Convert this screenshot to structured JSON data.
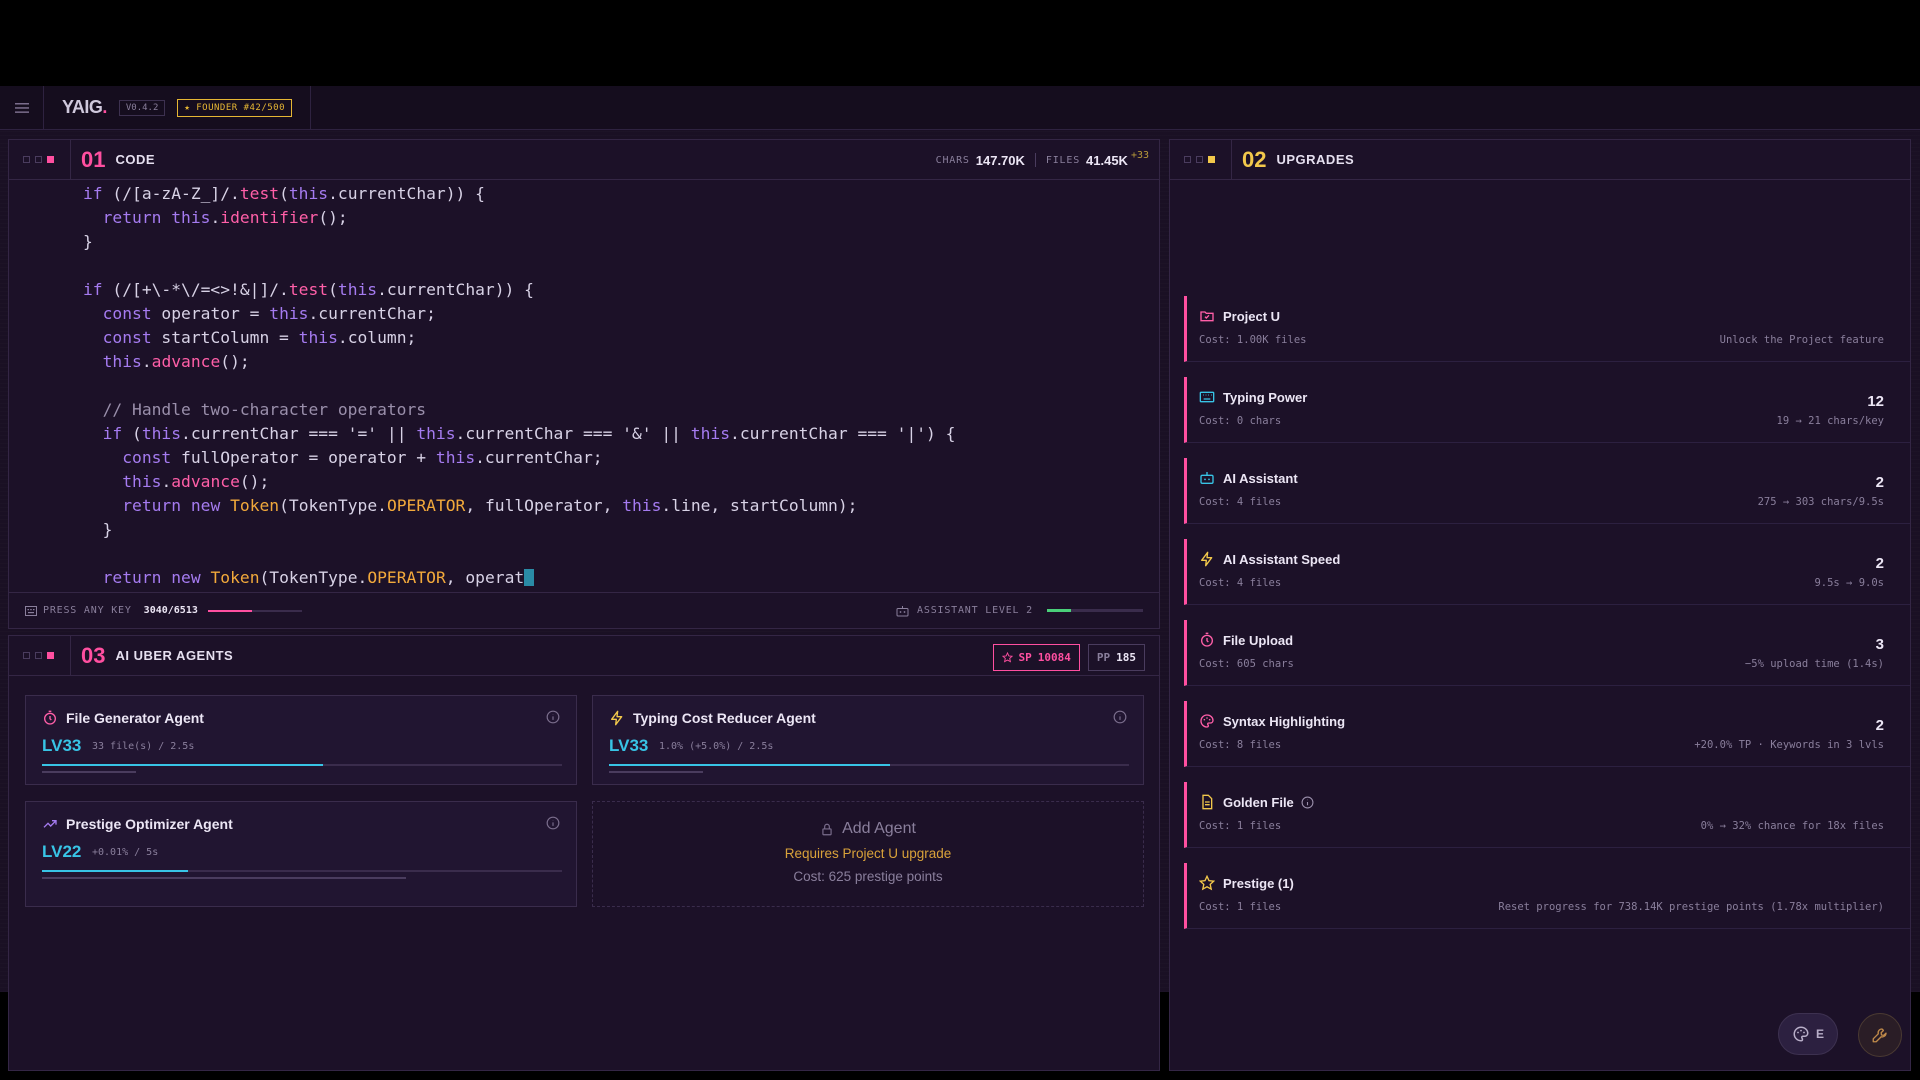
{
  "topbar": {
    "menu_icon": "hamburger-icon",
    "logo": "YAIG",
    "logo_dot": ".",
    "version": "V0.4.2",
    "founder": "★ FOUNDER #42/500"
  },
  "code_panel": {
    "number": "01",
    "title": "CODE",
    "chars_label": "CHARS",
    "chars_value": "147.70K",
    "files_label": "FILES",
    "files_value": "41.45K",
    "files_delta": "+33",
    "press_key_label": "PRESS ANY KEY",
    "progress": "3040/6513",
    "progress_fraction": 0.467,
    "assistant_label": "ASSISTANT LEVEL 2",
    "assistant_fraction": 0.25,
    "code_lines": [
      "if (/[a-zA-Z_]/.test(this.currentChar)) {",
      "  return this.identifier();",
      "}",
      "",
      "if (/[+\\-*\\/=<>!&|]/.test(this.currentChar)) {",
      "  const operator = this.currentChar;",
      "  const startColumn = this.column;",
      "  this.advance();",
      "",
      "  // Handle two-character operators",
      "  if (this.currentChar === '=' || this.currentChar === '&' || this.currentChar === '|') {",
      "    const fullOperator = operator + this.currentChar;",
      "    this.advance();",
      "    return new Token(TokenType.OPERATOR, fullOperator, this.line, startColumn);",
      "  }",
      "",
      "  return new Token(TokenType.OPERATOR, operat"
    ]
  },
  "agents_panel": {
    "number": "03",
    "title": "AI UBER AGENTS",
    "sp_label": "SP",
    "sp_value": "10084",
    "pp_label": "PP",
    "pp_value": "185",
    "agents": [
      {
        "name": "File Generator Agent",
        "icon": "timer-icon",
        "level": "LV33",
        "rate": "33 file(s) / 2.5s",
        "progress": 0.54,
        "secondary": 0.18
      },
      {
        "name": "Typing Cost Reducer Agent",
        "icon": "lightning-icon",
        "level": "LV33",
        "rate": "1.0% (+5.0%) / 2.5s",
        "progress": 0.54,
        "secondary": 0.18
      },
      {
        "name": "Prestige Optimizer Agent",
        "icon": "trending-up-icon",
        "level": "LV22",
        "rate": "+0.01% / 5s",
        "progress": 0.28,
        "secondary": 0.7
      }
    ],
    "add_agent": {
      "label": "Add Agent",
      "requires": "Requires Project U upgrade",
      "cost": "Cost: 625 prestige points"
    }
  },
  "upgrades_panel": {
    "number": "02",
    "title": "UPGRADES",
    "items": [
      {
        "name": "Project U",
        "icon": "project-icon",
        "cost": "Cost: 1.00K files",
        "level": "",
        "desc": "Unlock the Project feature"
      },
      {
        "name": "Typing Power",
        "icon": "keyboard-icon",
        "cost": "Cost: 0 chars",
        "level": "12",
        "desc": "19 → 21 chars/key"
      },
      {
        "name": "AI Assistant",
        "icon": "robot-icon",
        "cost": "Cost: 4 files",
        "level": "2",
        "desc": "275 → 303 chars/9.5s"
      },
      {
        "name": "AI Assistant Speed",
        "icon": "lightning-icon",
        "cost": "Cost: 4 files",
        "level": "2",
        "desc": "9.5s → 9.0s"
      },
      {
        "name": "File Upload",
        "icon": "timer-icon",
        "cost": "Cost: 605 chars",
        "level": "3",
        "desc": "−5% upload time (1.4s)"
      },
      {
        "name": "Syntax Highlighting",
        "icon": "palette-icon",
        "cost": "Cost: 8 files",
        "level": "2",
        "desc": "+20.0% TP · Keywords in 3 lvls"
      },
      {
        "name": "Golden File",
        "icon": "document-icon",
        "cost": "Cost: 1 files",
        "level": "",
        "desc": "0% → 32% chance for 18x files"
      },
      {
        "name": "Prestige (1)",
        "icon": "star-icon",
        "cost": "Cost: 1 files",
        "level": "",
        "desc": "Reset progress for 738.14K prestige points (1.78x multiplier)"
      }
    ]
  },
  "fab": {
    "theme_label": "E"
  },
  "colors": {
    "accent_pink": "#ff4fa0",
    "accent_gold": "#f2c84b",
    "accent_cyan": "#38c4e6",
    "accent_green": "#4ad07a"
  }
}
